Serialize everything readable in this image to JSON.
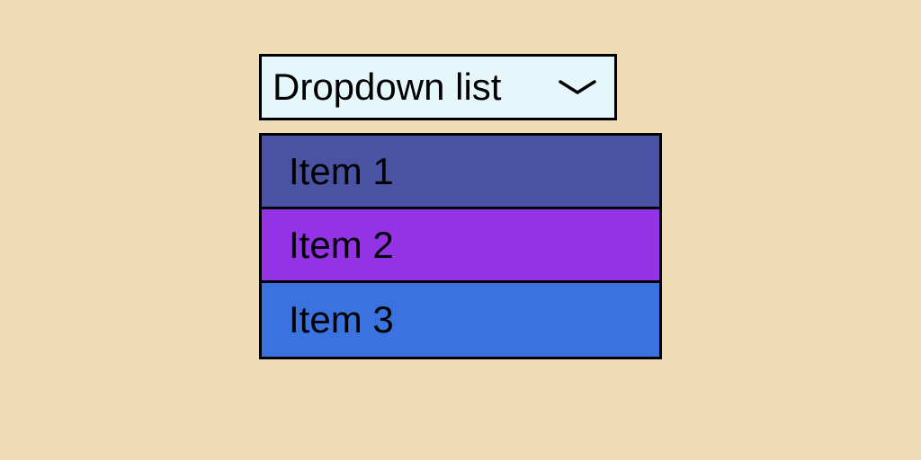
{
  "dropdown": {
    "label": "Dropdown list",
    "items": [
      {
        "label": "Item 1",
        "bg": "#4a52a3"
      },
      {
        "label": "Item 2",
        "bg": "#9432e6"
      },
      {
        "label": "Item 3",
        "bg": "#3a72e0"
      }
    ]
  },
  "colors": {
    "page_bg": "#f0dcb4",
    "header_bg": "#e6f7fb",
    "border": "#000000"
  }
}
